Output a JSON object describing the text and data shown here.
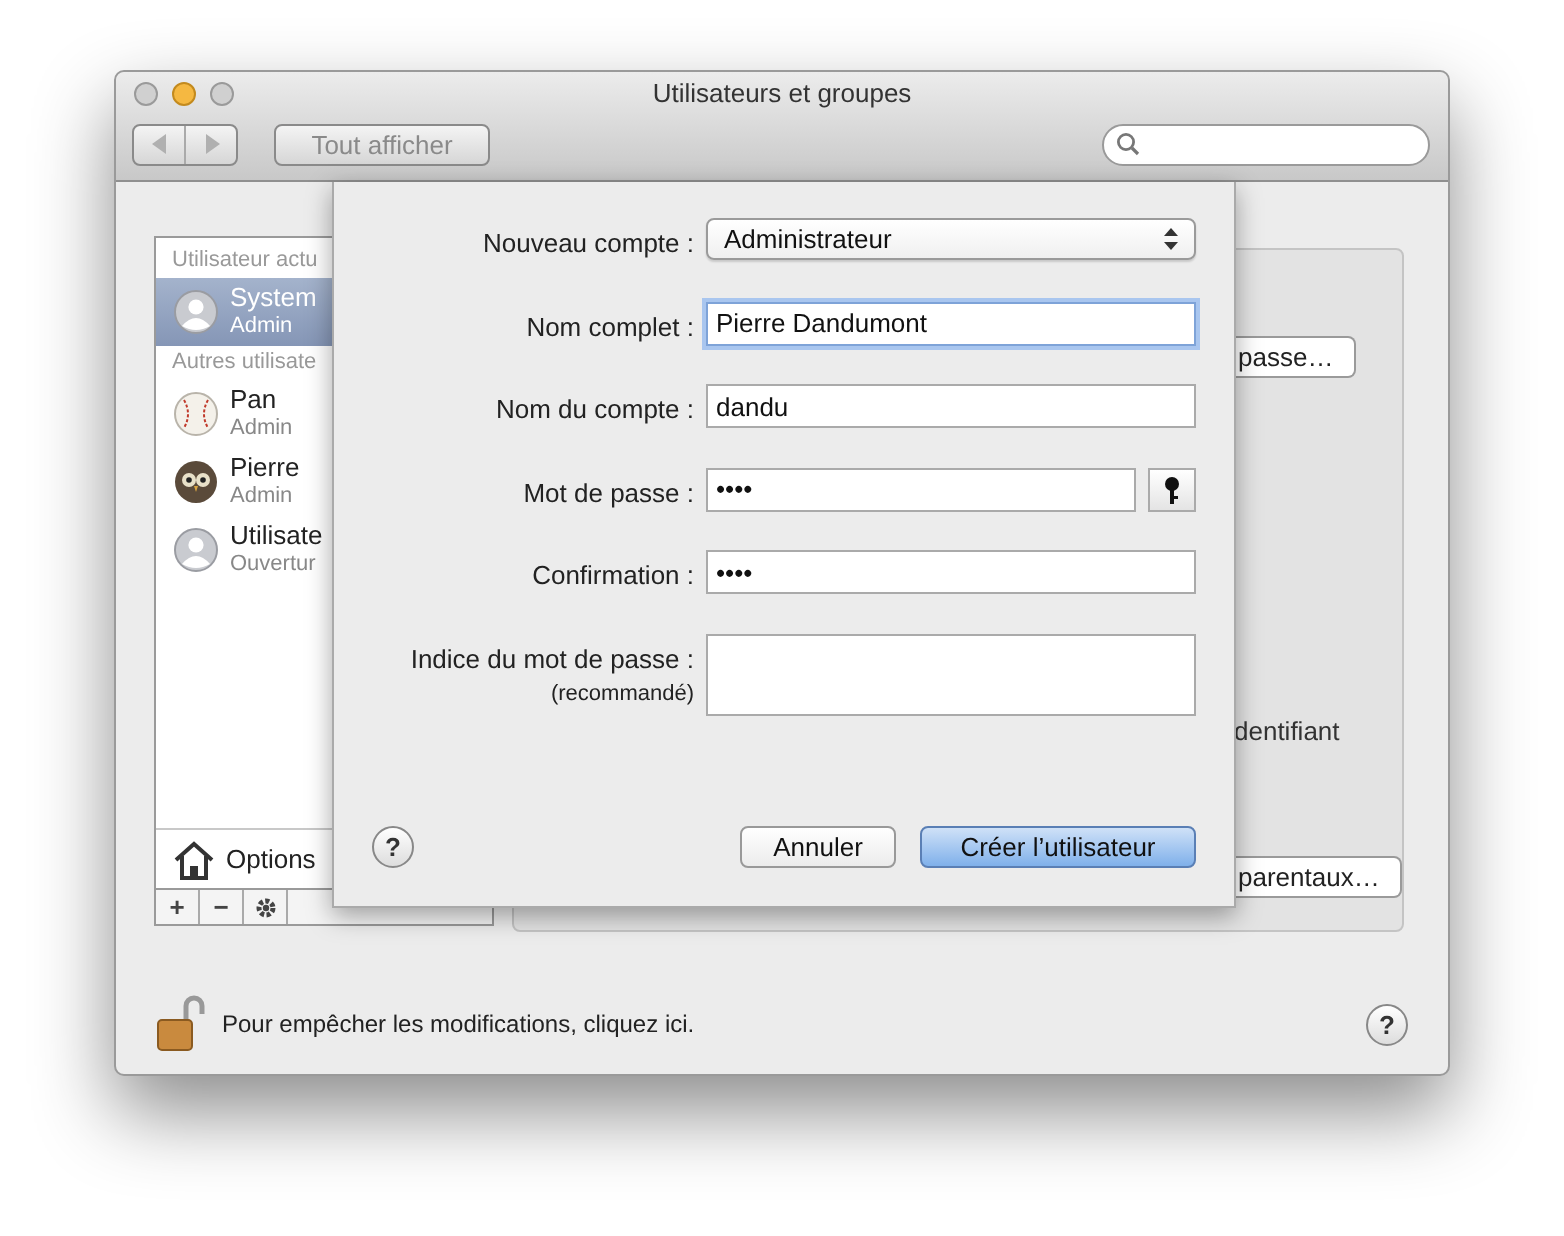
{
  "window": {
    "title": "Utilisateurs et groupes"
  },
  "toolbar": {
    "show_all": "Tout afficher"
  },
  "sidebar": {
    "sections": [
      {
        "header": "Utilisateur actu",
        "users": [
          {
            "name": "System",
            "role": "Admin",
            "kind": "silhouette",
            "selected": true
          }
        ]
      },
      {
        "header": "Autres utilisate",
        "users": [
          {
            "name": "Pan",
            "role": "Admin",
            "kind": "baseball",
            "selected": false
          },
          {
            "name": "Pierre",
            "role": "Admin",
            "kind": "owl",
            "selected": false
          },
          {
            "name": "Utilisate",
            "role": "Ouvertur",
            "kind": "silhouette",
            "selected": false
          }
        ]
      }
    ],
    "options": "Options",
    "add": "+",
    "remove": "−"
  },
  "right_panel": {
    "password_button": "passe…",
    "apple_id_text": "dentifiant",
    "parental_button": "parentaux…"
  },
  "sheet": {
    "fields": [
      {
        "label": "Nouveau compte :",
        "kind": "popup",
        "value": "Administrateur"
      },
      {
        "label": "Nom complet :",
        "kind": "text",
        "value": "Pierre Dandumont",
        "focused": true
      },
      {
        "label": "Nom du compte :",
        "kind": "text",
        "value": "dandu",
        "focused": false
      },
      {
        "label": "Mot de passe :",
        "kind": "password",
        "value": "••••",
        "key_button": true
      },
      {
        "label": "Confirmation :",
        "kind": "password",
        "value": "••••",
        "key_button": false
      },
      {
        "label": "Indice du mot de passe :",
        "sublabel": "(recommandé)",
        "kind": "textarea"
      }
    ],
    "help": "?",
    "buttons": [
      {
        "label": "Annuler",
        "default": false
      },
      {
        "label": "Créer l’utilisateur",
        "default": true
      }
    ]
  },
  "footer": {
    "lock_text": "Pour empêcher les modifications, cliquez ici.",
    "help": "?"
  }
}
